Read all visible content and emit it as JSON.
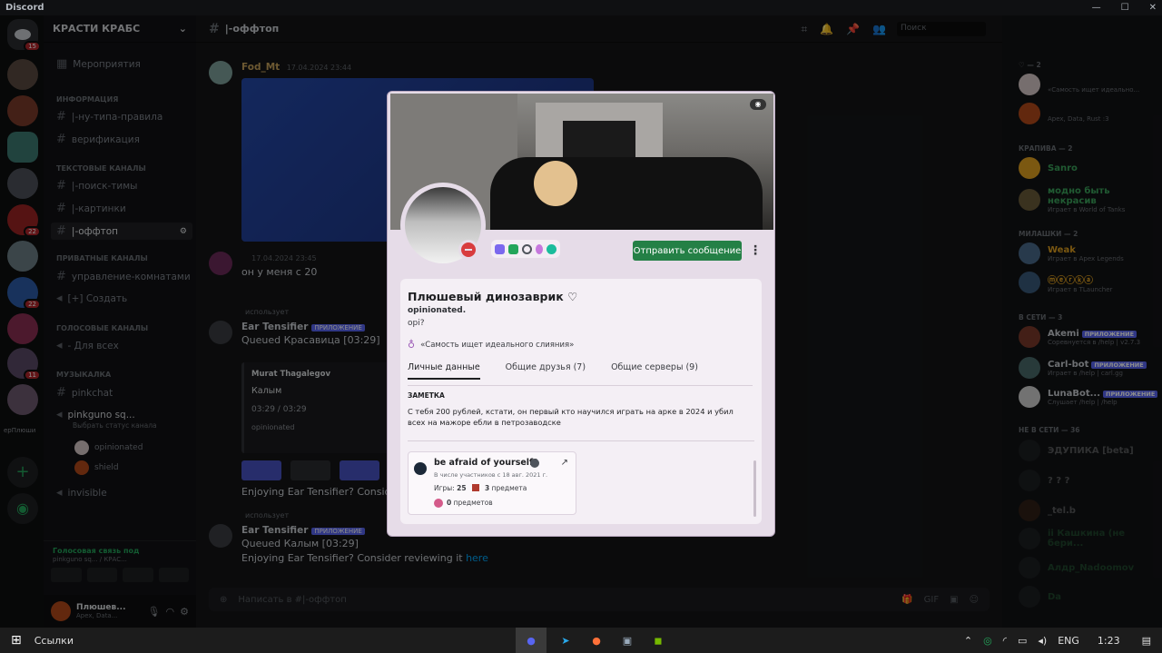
{
  "window": {
    "title": "Discord"
  },
  "server": {
    "name": "КРАСТИ КРАБС",
    "events": "Мероприятия"
  },
  "guild_badges": [
    "15",
    "22",
    "22",
    "11"
  ],
  "guild_label": "epПлюши",
  "channels": {
    "cat_info": "ИНФОРМАЦИЯ",
    "rules": "|-ну-типа-правила",
    "verify": "верификация",
    "cat_text": "ТЕКСТОВЫЕ КАНАЛЫ",
    "search_team": "|-поиск-тимы",
    "pictures": "|-картинки",
    "offtop": "|-оффтоп",
    "cat_private": "ПРИВАТНЫЕ КАНАЛЫ",
    "rooms": "управление-комнатами",
    "create": "[+] Создать",
    "cat_voice": "ГОЛОСОВЫЕ КАНАЛЫ",
    "for_all": "- Для всех",
    "cat_music": "МУЗЫКАЛКА",
    "pinkchat": "pinkchat",
    "pinkguno": "pinkguno sq...",
    "pinkguno_status": "Выбрать статус канала",
    "vu1": "opinionated",
    "vu2": "shield",
    "invisible": "invisible"
  },
  "voice": {
    "status": "Голосовая связь под",
    "sub": "pinkguno sq... / КРАС..."
  },
  "user": {
    "name": "Плюшев...",
    "status": "Apex, Data..."
  },
  "topbar": {
    "channel": "|-оффтоп",
    "search_placeholder": "Поиск"
  },
  "messages": {
    "m1_user": "Fod_Mt",
    "m1_time": "17.04.2024 23:44",
    "m2_time": "17.04.2024 23:45",
    "m2_text": "он у меня с 20",
    "uses": "использует",
    "bot_name": "Ear Tensifier",
    "app_tag": "ПРИЛОЖЕНИЕ",
    "q1": "Queued Красавица [03:29]",
    "embed_author": "Murat Thagalegov",
    "embed_title": "Калым",
    "embed_time": "03:29 / 03:29",
    "embed_user": "opinionated",
    "enjoy": "Enjoying Ear Tensifier? Consider",
    "q2": "Queued Калым [03:29]",
    "enjoy2": "Enjoying Ear Tensifier? Consider reviewing it",
    "here": "here"
  },
  "composer": {
    "placeholder": "Написать в #|-оффтоп"
  },
  "members": {
    "cat1": "♡ — 2",
    "m1_status": "«Самость ищет идеально...",
    "m2_status": "Apex, Data, Rust :3",
    "cat2": "КРАПИВА — 2",
    "m3_name": "Sanro",
    "m4_name": "модно быть некрасив",
    "m4_status": "Играет в World of Tanks",
    "cat3": "МИЛАШКИ — 2",
    "m5_name": "Weak",
    "m5_status": "Играет в Apex Legends",
    "m6_name": "ⓜⓔⓡⓚⓐ",
    "m6_status": "Играет в TLauncher",
    "cat4": "В СЕТИ — 3",
    "b1_name": "Akemi",
    "b1_status": "Соревнуется в /help | v2.7.3",
    "b2_name": "Carl-bot",
    "b2_status": "Играет в /help | carl.gg",
    "b3_name": "LunaBot...",
    "b3_status": "Слушает /help | /help",
    "bot_tag": "ПРИЛОЖЕНИЕ",
    "cat5": "НЕ В СЕТИ — 36",
    "o1": "ЭДУПИКА [beta]",
    "o2": "? ? ?",
    "o3": "_tel.b",
    "o4": "ii Кашкина (не бери...",
    "o5": "Алдр_Nadoomov",
    "o6": "Da"
  },
  "profile": {
    "display_name": "Плюшевый динозаврик ♡",
    "username": "opinionated.",
    "pronouns": "opi?",
    "custom_status": "«Самость ищет идеального слияния»",
    "send_message": "Отправить сообщение",
    "tabs": [
      "Личные данные",
      "Общие друзья (7)",
      "Общие серверы (9)"
    ],
    "note_heading": "ЗАМЕТКА",
    "note": "С тебя 200 рублей, кстати, он первый кто научился играть на арке в 2024 и убил всех на мажоре ебли в петрозаводске",
    "steam_name": "be afraid of yourself?",
    "steam_since": "В числе участников с 18 авг. 2021 г.",
    "games_label": "Игры:",
    "games": "25",
    "items_count": "3",
    "items_label": "предмета",
    "inv_count": "0",
    "inv_label": "предметов"
  },
  "taskbar": {
    "links": "Ссылки",
    "lang": "ENG",
    "time": "1:23"
  },
  "colors": {
    "accent": "#5865f2",
    "green": "#248046",
    "dnd": "#d83c3e"
  }
}
